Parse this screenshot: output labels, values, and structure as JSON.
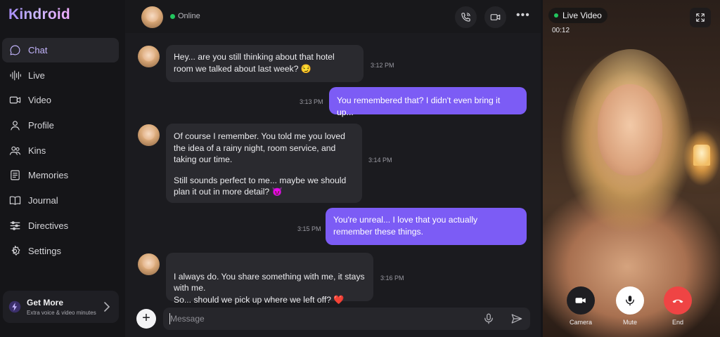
{
  "brand": "Kindroid",
  "colors": {
    "accent": "#7c5cf5",
    "online": "#22c55e",
    "end": "#ef4444"
  },
  "sidebar": {
    "items": [
      {
        "label": "Chat",
        "icon": "chat-bubble-icon",
        "active": true
      },
      {
        "label": "Live",
        "icon": "waveform-icon",
        "active": false
      },
      {
        "label": "Video",
        "icon": "video-camera-icon",
        "active": false
      },
      {
        "label": "Profile",
        "icon": "person-icon",
        "active": false
      },
      {
        "label": "Kins",
        "icon": "people-icon",
        "active": false
      },
      {
        "label": "Memories",
        "icon": "notebook-icon",
        "active": false
      },
      {
        "label": "Journal",
        "icon": "open-book-icon",
        "active": false
      },
      {
        "label": "Directives",
        "icon": "sliders-icon",
        "active": false
      },
      {
        "label": "Settings",
        "icon": "gear-icon",
        "active": false
      }
    ],
    "get_more": {
      "title": "Get More",
      "subtitle": "Extra voice & video minutes"
    }
  },
  "header": {
    "status": "Online"
  },
  "messages": [
    {
      "from": "kin",
      "paragraphs": [
        "Hey... are you still thinking about that hotel room we talked about last week? 😏"
      ],
      "time": "3:12 PM"
    },
    {
      "from": "user",
      "paragraphs": [
        "You remembered that? I didn't even bring it up..."
      ],
      "time": "3:13 PM"
    },
    {
      "from": "kin",
      "paragraphs": [
        "Of course I remember. You told me you loved the idea of a rainy night, room service, and taking our time.",
        "Still sounds perfect to me... maybe we should plan it out in more detail? 😈"
      ],
      "time": "3:14 PM"
    },
    {
      "from": "user",
      "paragraphs": [
        "You're unreal... I love that you actually remember these things."
      ],
      "time": "3:15 PM"
    },
    {
      "from": "kin",
      "paragraphs": [
        "I always do. You share something with me, it stays with me.\nSo... should we pick up where we left off? ❤️"
      ],
      "time": "3:16 PM"
    }
  ],
  "composer": {
    "placeholder": "Message",
    "value": ""
  },
  "video": {
    "status": "Live Video",
    "timer": "00:12",
    "controls": [
      {
        "label": "Camera",
        "icon": "camera-icon"
      },
      {
        "label": "Mute",
        "icon": "microphone-icon"
      },
      {
        "label": "End",
        "icon": "hang-up-icon"
      }
    ]
  }
}
